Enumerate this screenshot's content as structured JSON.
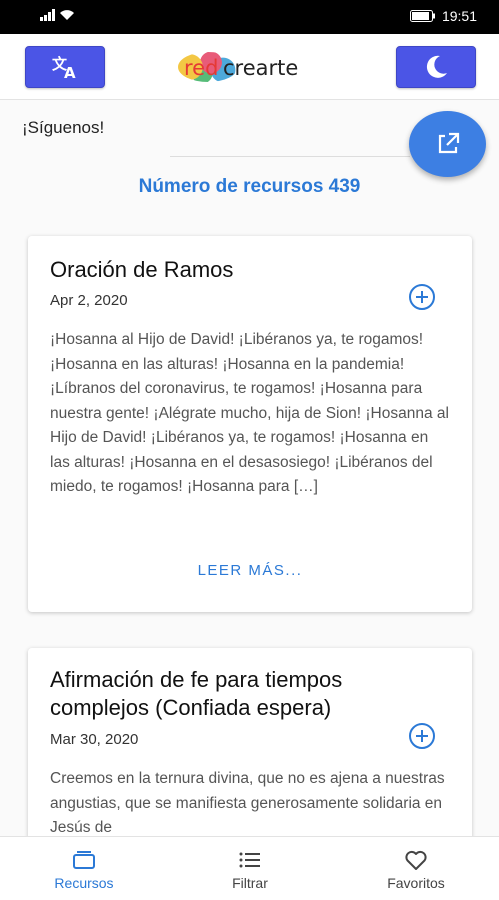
{
  "status_bar": {
    "time": "19:51"
  },
  "header": {
    "translate_icon": "translate-icon",
    "theme_icon": "moon-icon",
    "logo_red": "red",
    "logo_rest": "crearte"
  },
  "follow_label": "¡Síguenos!",
  "resource_count": "Número de recursos 439",
  "cards": [
    {
      "title": "Oración de Ramos",
      "date": "Apr 2, 2020",
      "excerpt": "¡Hosanna al Hijo de David! ¡Libéranos ya, te rogamos! ¡Hosanna en las alturas! ¡Hosanna en la pandemia! ¡Líbranos del coronavirus, te rogamos! ¡Hosanna para nuestra gente! ¡Alégrate mucho, hija de Sion! ¡Hosanna al Hijo de David! ¡Libéranos ya, te rogamos! ¡Hosanna en las alturas! ¡Hosanna en el desasosiego! ¡Libéranos del miedo, te rogamos! ¡Hosanna para […]",
      "read_more": "LEER MÁS..."
    },
    {
      "title": "Afirmación de fe para tiempos complejos (Confiada espera)",
      "date": "Mar 30, 2020",
      "excerpt": "Creemos en la ternura divina, que no es ajena a nuestras angustias, que se manifiesta generosamente solidaria en Jesús de"
    }
  ],
  "bottom_nav": [
    {
      "label": "Recursos",
      "icon": "folder-icon",
      "active": true
    },
    {
      "label": "Filtrar",
      "icon": "filter-list-icon",
      "active": false
    },
    {
      "label": "Favoritos",
      "icon": "heart-icon",
      "active": false
    }
  ],
  "colors": {
    "accent": "#2b79d6",
    "header_button": "#4b55e6",
    "fab": "#3d7fe3"
  }
}
